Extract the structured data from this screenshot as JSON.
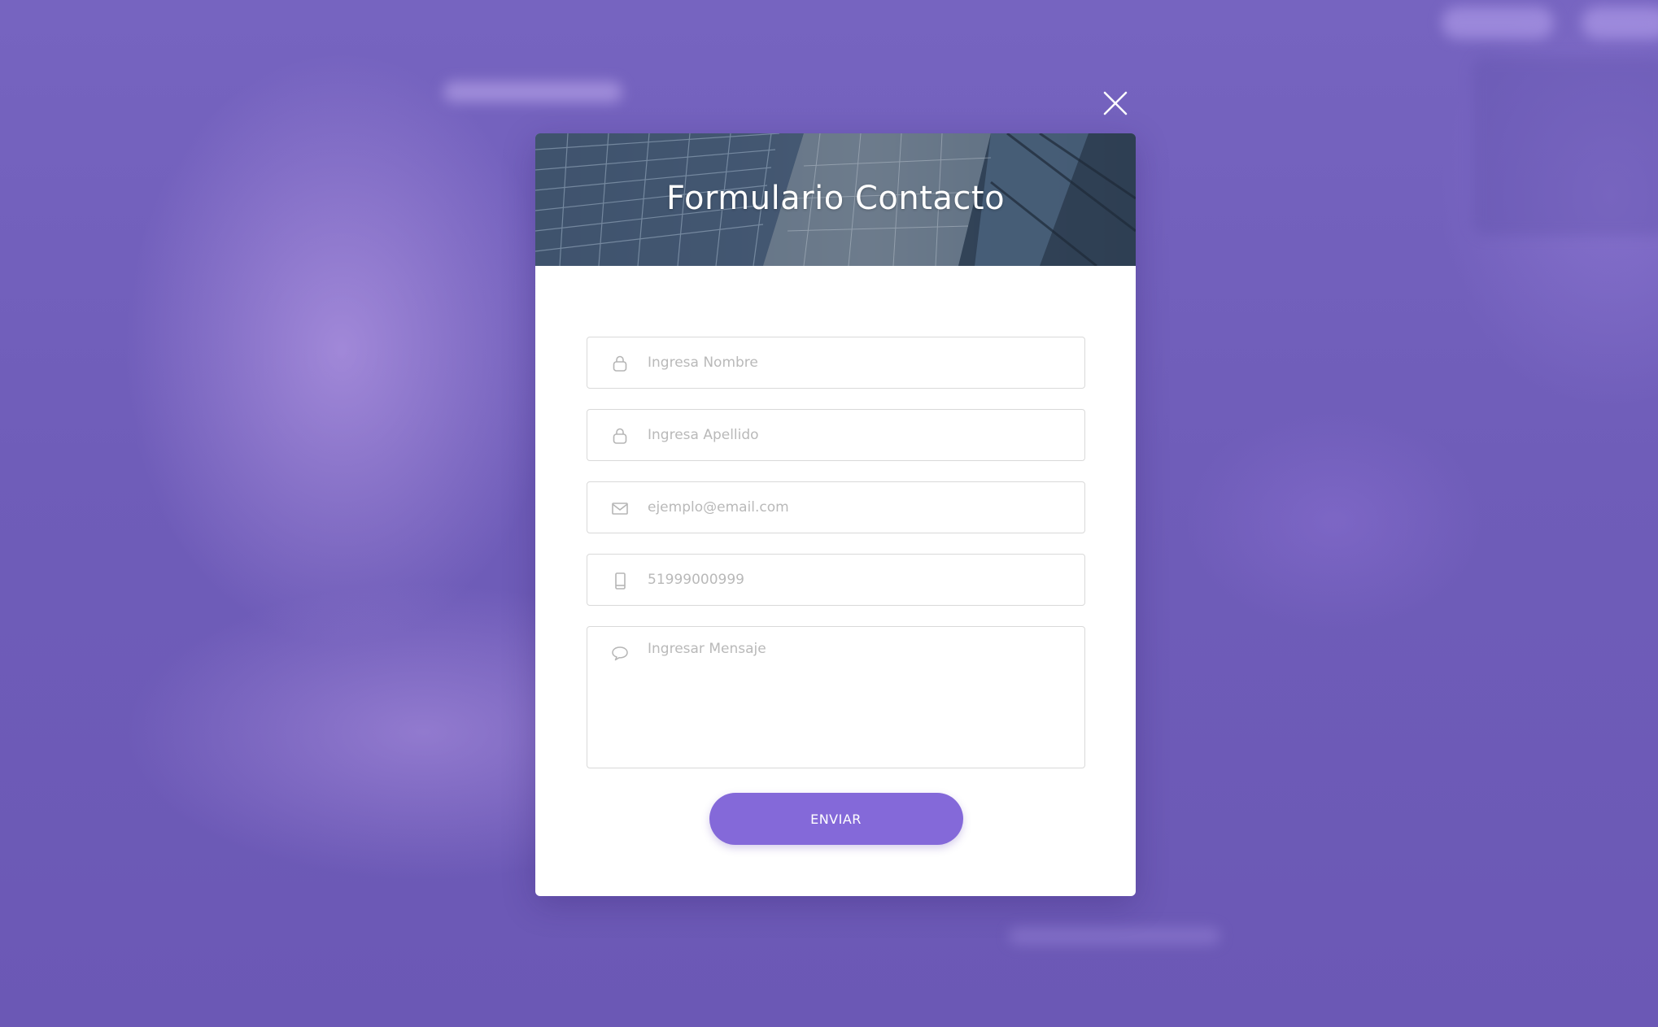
{
  "modal": {
    "title": "Formulario Contacto"
  },
  "form": {
    "nombre_placeholder": "Ingresa Nombre",
    "apellido_placeholder": "Ingresa Apellido",
    "email_placeholder": "ejemplo@email.com",
    "telefono_placeholder": "51999000999",
    "mensaje_placeholder": "Ingresar Mensaje",
    "submit_label": "ENVIAR"
  },
  "icons": {
    "close": "close-icon",
    "nombre": "user-icon",
    "apellido": "user-icon",
    "email": "envelope-icon",
    "telefono": "mobile-phone-icon",
    "mensaje": "speech-bubble-icon"
  },
  "colors": {
    "backdrop": "#7060bb",
    "accent": "#8469d9",
    "field_border": "#d9d9d9",
    "placeholder": "#b9b9b9"
  }
}
